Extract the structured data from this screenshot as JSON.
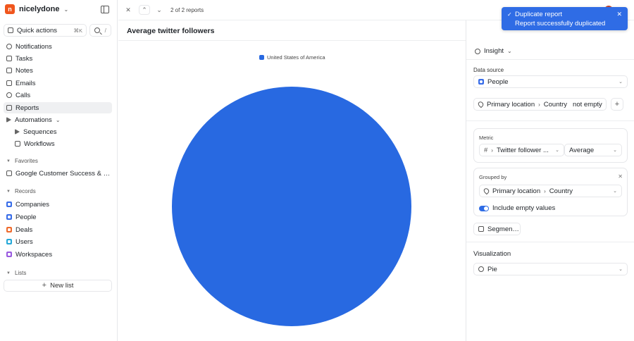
{
  "workspace": {
    "name": "nicelydone",
    "logo_letter": "n"
  },
  "sidebar": {
    "quick_actions": {
      "label": "Quick actions",
      "shortcut": "⌘K"
    },
    "search_hint": "/",
    "nav": [
      {
        "label": "Notifications",
        "icon": "bell-icon"
      },
      {
        "label": "Tasks",
        "icon": "check-square-icon"
      },
      {
        "label": "Notes",
        "icon": "note-icon"
      },
      {
        "label": "Emails",
        "icon": "mail-icon"
      },
      {
        "label": "Calls",
        "icon": "phone-icon"
      },
      {
        "label": "Reports",
        "icon": "report-icon",
        "active": true
      },
      {
        "label": "Automations",
        "icon": "automation-icon"
      }
    ],
    "automations_sub": [
      {
        "label": "Sequences",
        "icon": "send-icon"
      },
      {
        "label": "Workflows",
        "icon": "workflow-icon"
      }
    ],
    "favorites_label": "Favorites",
    "favorites": [
      {
        "label": "Google Customer Success & P..."
      }
    ],
    "records_label": "Records",
    "records": [
      {
        "label": "Companies",
        "color": "#3a6ee8"
      },
      {
        "label": "People",
        "color": "#3a6ee8"
      },
      {
        "label": "Deals",
        "color": "#ef6b2d"
      },
      {
        "label": "Users",
        "color": "#27a9d8"
      },
      {
        "label": "Workspaces",
        "color": "#9a5be0"
      }
    ],
    "lists_label": "Lists",
    "new_list_label": "New list"
  },
  "topbar": {
    "counter": "2 of 2 reports"
  },
  "report": {
    "title": "Average twitter followers"
  },
  "chart_data": {
    "type": "pie",
    "title": "",
    "legend": [
      "United States of America"
    ],
    "series": [
      {
        "name": "United States of America",
        "values": [
          1
        ],
        "color": "#2869e1"
      }
    ],
    "categories": [
      "United States of America"
    ],
    "values": [
      100
    ],
    "legend_position": "top"
  },
  "panel": {
    "insight_label": "Insight",
    "data_source_label": "Data source",
    "data_source_value": "People",
    "filter": {
      "field": "Primary location",
      "subfield": "Country",
      "condition": "not empty"
    },
    "metric_label": "Metric",
    "metric_field": "Twitter follower ...",
    "metric_agg": "Average",
    "grouped_by_label": "Grouped by",
    "grouped_field": "Primary location",
    "grouped_subfield": "Country",
    "include_empty_label": "Include empty values",
    "segment_by_label": "Segment by",
    "visualization_label": "Visualization",
    "visualization_value": "Pie"
  },
  "toast": {
    "title": "Duplicate report",
    "message": "Report successfully duplicated"
  },
  "colors": {
    "accent": "#2f6ce5",
    "pie": "#2869e1"
  }
}
